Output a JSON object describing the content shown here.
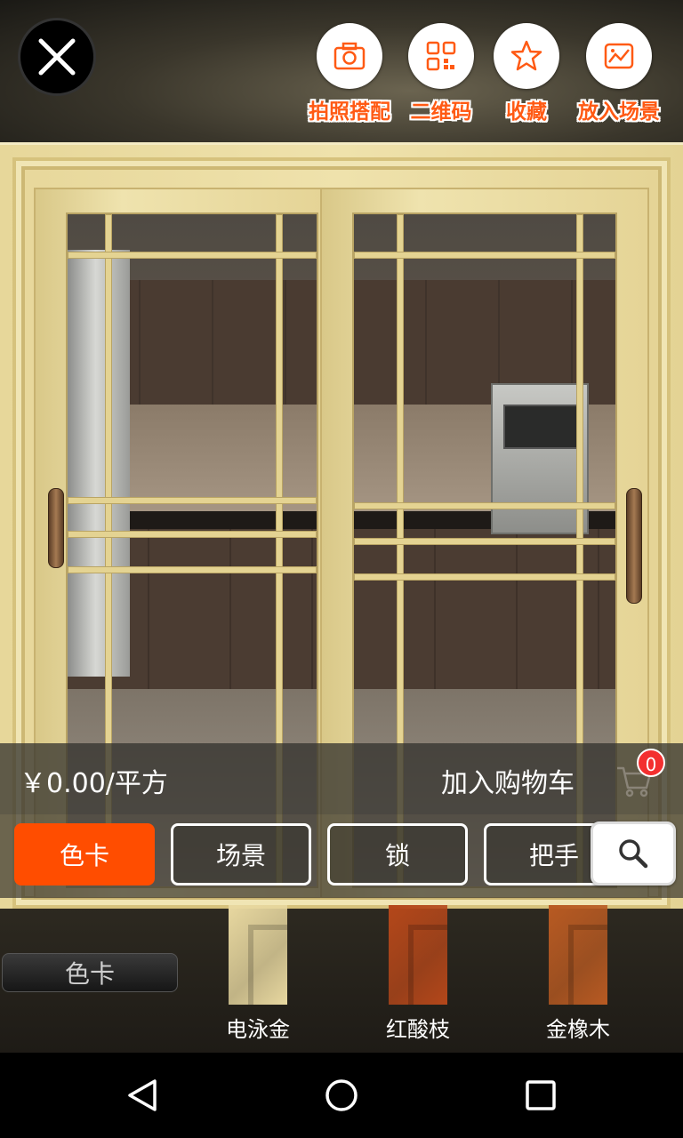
{
  "toolbar": {
    "close_icon": "close-icon",
    "items": [
      {
        "label": "拍照搭配",
        "icon": "camera-icon"
      },
      {
        "label": "二维码",
        "icon": "qr-code-icon"
      },
      {
        "label": "收藏",
        "icon": "star-icon"
      },
      {
        "label": "放入场景",
        "icon": "scene-image-icon"
      }
    ],
    "label_color": "#ff5a14"
  },
  "price_bar": {
    "price": "￥0.00/平方",
    "add_to_cart": "加入购物车",
    "cart_count": "0"
  },
  "tabs": {
    "items": [
      "色卡",
      "场景",
      "锁",
      "把手"
    ],
    "active": "色卡",
    "active_color": "#ff4d00",
    "search_icon": "search-icon"
  },
  "color_strip": {
    "title": "色卡",
    "swatches": [
      {
        "label": "电泳金",
        "color": "#e8d8a0"
      },
      {
        "label": "红酸枝",
        "color": "#b4471a"
      },
      {
        "label": "金橡木",
        "color": "#b85a22"
      }
    ]
  },
  "navbar": {
    "back_icon": "back-triangle-icon",
    "home_icon": "home-circle-icon",
    "recents_icon": "recents-square-icon"
  }
}
